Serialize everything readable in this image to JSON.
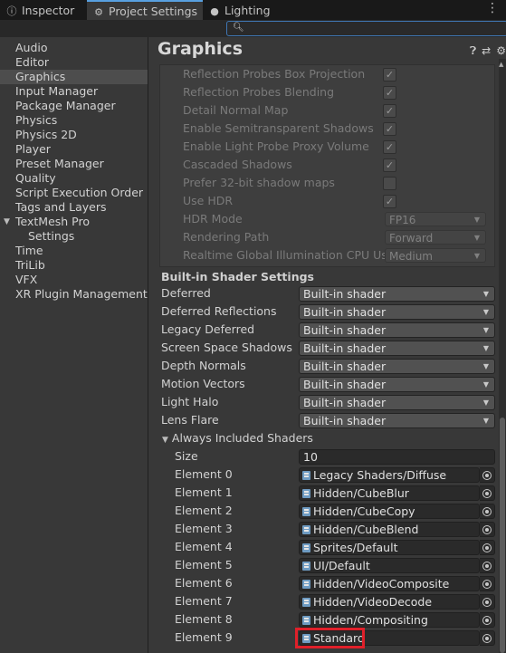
{
  "tabs": [
    {
      "label": "Inspector",
      "icon": "info-icon"
    },
    {
      "label": "Project Settings",
      "icon": "gear-icon",
      "active": true
    },
    {
      "label": "Lighting",
      "icon": "lightbulb-icon"
    }
  ],
  "search": {
    "value": "",
    "placeholder": ""
  },
  "sidebar": {
    "items": [
      {
        "label": "Audio"
      },
      {
        "label": "Editor"
      },
      {
        "label": "Graphics",
        "selected": true
      },
      {
        "label": "Input Manager"
      },
      {
        "label": "Package Manager"
      },
      {
        "label": "Physics"
      },
      {
        "label": "Physics 2D"
      },
      {
        "label": "Player"
      },
      {
        "label": "Preset Manager"
      },
      {
        "label": "Quality"
      },
      {
        "label": "Script Execution Order"
      },
      {
        "label": "Tags and Layers"
      },
      {
        "label": "TextMesh Pro",
        "expanded": true
      },
      {
        "label": "Settings",
        "child": true
      },
      {
        "label": "Time"
      },
      {
        "label": "TriLib"
      },
      {
        "label": "VFX"
      },
      {
        "label": "XR Plugin Management"
      }
    ]
  },
  "main": {
    "title": "Graphics",
    "tier_settings": [
      {
        "label": "Reflection Probes Box Projection",
        "checked": true
      },
      {
        "label": "Reflection Probes Blending",
        "checked": true
      },
      {
        "label": "Detail Normal Map",
        "checked": true
      },
      {
        "label": "Enable Semitransparent Shadows",
        "checked": true
      },
      {
        "label": "Enable Light Probe Proxy Volume",
        "checked": true
      },
      {
        "label": "Cascaded Shadows",
        "checked": true
      },
      {
        "label": "Prefer 32-bit shadow maps",
        "checked": false
      },
      {
        "label": "Use HDR",
        "checked": true
      },
      {
        "label": "HDR Mode",
        "value": "FP16"
      },
      {
        "label": "Rendering Path",
        "value": "Forward"
      },
      {
        "label": "Realtime Global Illumination CPU Us",
        "value": "Medium"
      }
    ],
    "builtin_section_title": "Built-in Shader Settings",
    "builtin_shaders": [
      {
        "label": "Deferred",
        "value": "Built-in shader"
      },
      {
        "label": "Deferred Reflections",
        "value": "Built-in shader"
      },
      {
        "label": "Legacy Deferred",
        "value": "Built-in shader"
      },
      {
        "label": "Screen Space Shadows",
        "value": "Built-in shader"
      },
      {
        "label": "Depth Normals",
        "value": "Built-in shader"
      },
      {
        "label": "Motion Vectors",
        "value": "Built-in shader"
      },
      {
        "label": "Light Halo",
        "value": "Built-in shader"
      },
      {
        "label": "Lens Flare",
        "value": "Built-in shader"
      }
    ],
    "always_included": {
      "title": "Always Included Shaders",
      "size_label": "Size",
      "size_value": "10",
      "elements": [
        {
          "label": "Element 0",
          "value": "Legacy Shaders/Diffuse"
        },
        {
          "label": "Element 1",
          "value": "Hidden/CubeBlur"
        },
        {
          "label": "Element 2",
          "value": "Hidden/CubeCopy"
        },
        {
          "label": "Element 3",
          "value": "Hidden/CubeBlend"
        },
        {
          "label": "Element 4",
          "value": "Sprites/Default"
        },
        {
          "label": "Element 5",
          "value": "UI/Default"
        },
        {
          "label": "Element 6",
          "value": "Hidden/VideoComposite"
        },
        {
          "label": "Element 7",
          "value": "Hidden/VideoDecode"
        },
        {
          "label": "Element 8",
          "value": "Hidden/Compositing"
        },
        {
          "label": "Element 9",
          "value": "Standard",
          "highlighted": true
        }
      ]
    }
  },
  "colors": {
    "accent": "#3f76b3",
    "highlight": "#e0202a",
    "selected_bg": "#4d4d4d"
  }
}
